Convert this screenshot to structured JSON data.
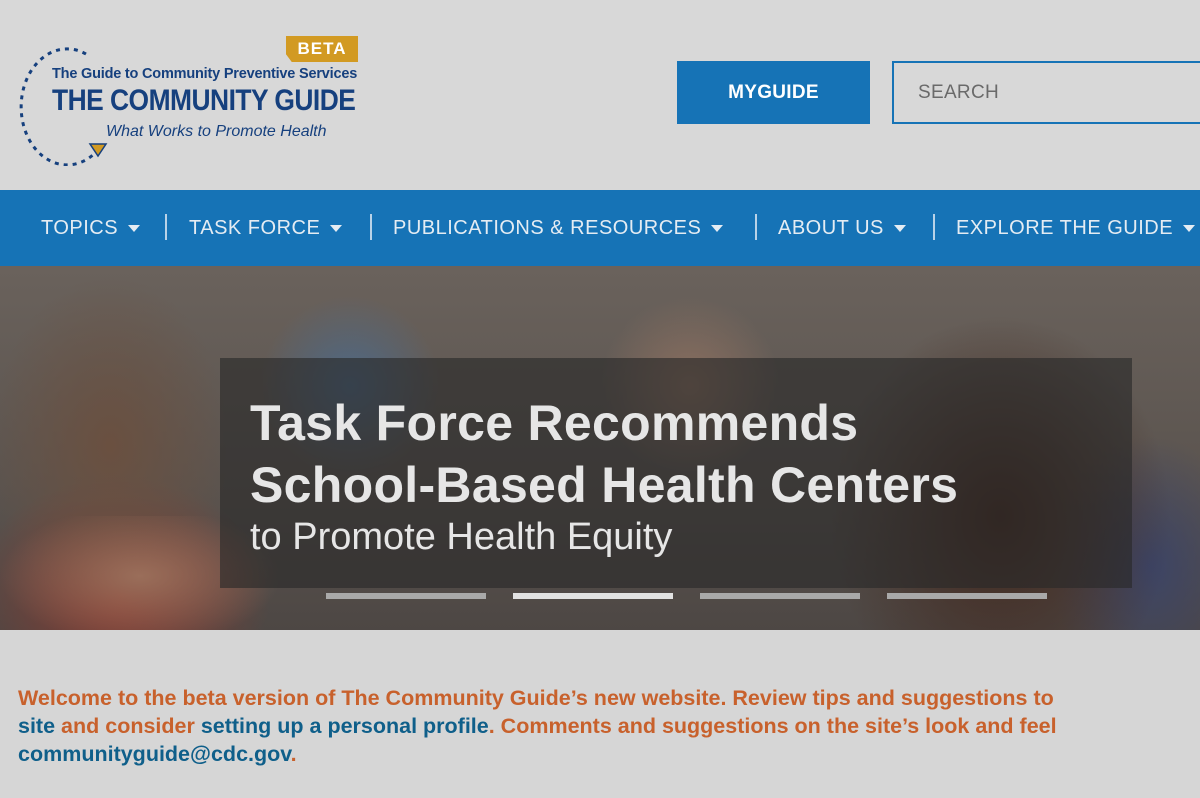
{
  "logo": {
    "beta": "BETA",
    "subtitle": "The Guide to Community Preventive Services",
    "title": "THE COMMUNITY GUIDE",
    "tagline": "What Works to Promote Health"
  },
  "header": {
    "myguide_label": "MYGUIDE",
    "search_placeholder": "SEARCH"
  },
  "nav": {
    "items": [
      {
        "label": "TOPICS"
      },
      {
        "label": "TASK FORCE"
      },
      {
        "label": "PUBLICATIONS & RESOURCES"
      },
      {
        "label": "ABOUT US"
      },
      {
        "label": "EXPLORE THE GUIDE"
      }
    ]
  },
  "hero": {
    "line1": "Task Force Recommends",
    "line2": "School-Based Health Centers",
    "line3": "to Promote Health Equity",
    "slides": 4,
    "active_slide": 2
  },
  "welcome": {
    "l1": "Welcome to the beta version of The Community Guide’s new website. Review tips and suggestions to",
    "l2_link1": "site",
    "l2_text1": " and consider ",
    "l2_link2": "setting up a personal profile",
    "l2_text2": ". Comments and suggestions on the site’s look and feel",
    "l3_link": "communityguide@cdc.gov",
    "l3_text": "."
  },
  "colors": {
    "brand_blue": "#1673b6",
    "logo_navy": "#16407e",
    "beta_gold": "#d29a22",
    "welcome_orange": "#c8612c",
    "link_teal": "#0f5f8a"
  }
}
